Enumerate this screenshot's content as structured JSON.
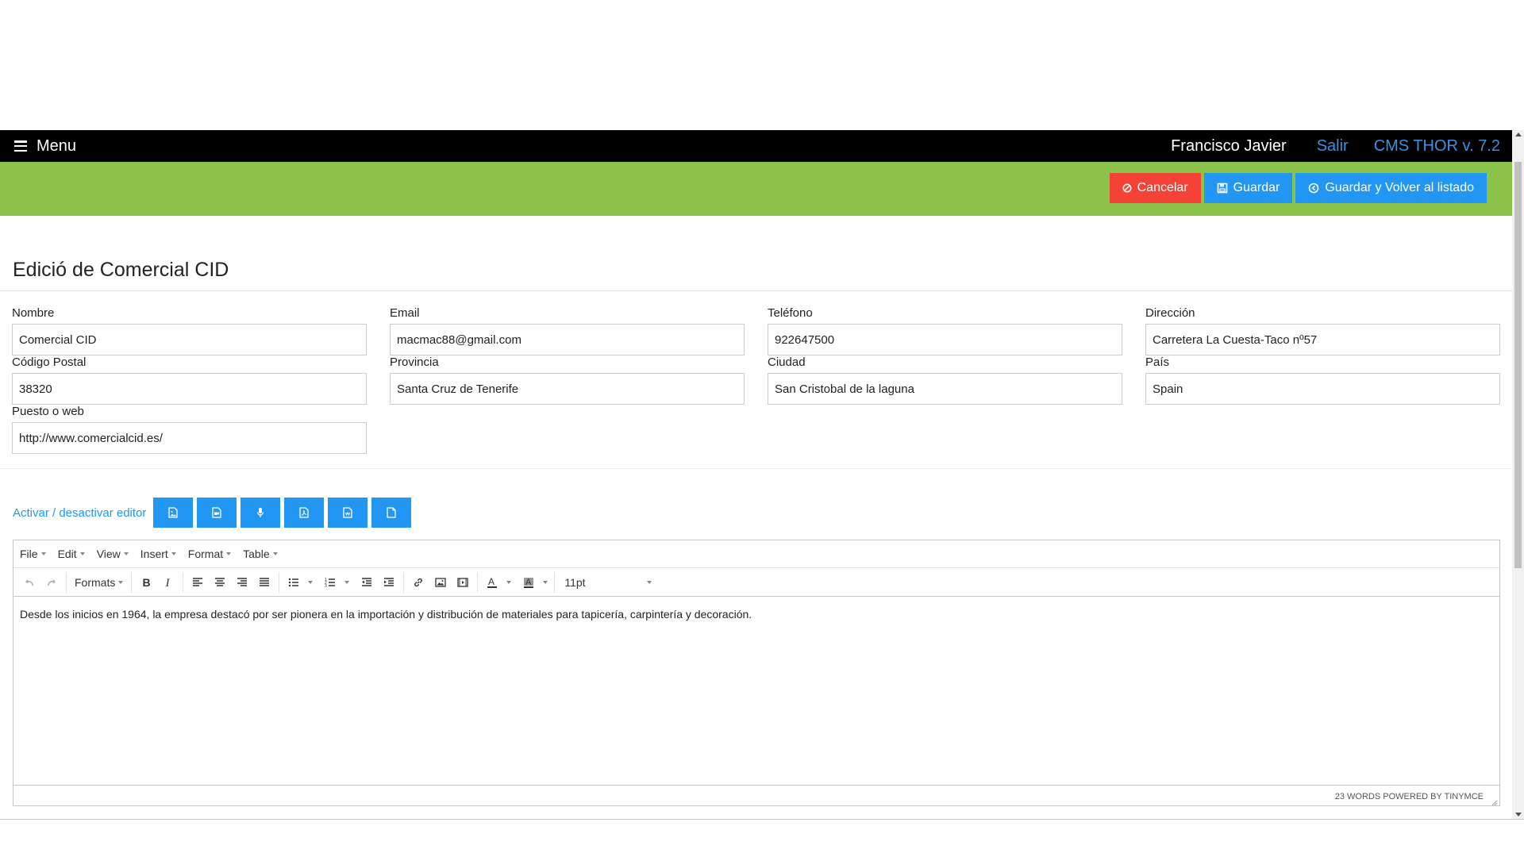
{
  "nav": {
    "menu_label": "Menu",
    "user_name": "Francisco Javier",
    "logout_label": "Salir",
    "version_label": "CMS THOR v. 7.2"
  },
  "actions": {
    "cancel_label": "Cancelar",
    "save_label": "Guardar",
    "save_return_label": "Guardar y Volver al listado"
  },
  "page": {
    "title": "Edició de Comercial CID"
  },
  "fields": {
    "nombre": {
      "label": "Nombre",
      "value": "Comercial CID"
    },
    "email": {
      "label": "Email",
      "value": "macmac88@gmail.com"
    },
    "telefono": {
      "label": "Teléfono",
      "value": "922647500"
    },
    "direccion": {
      "label": "Dirección",
      "value": "Carretera La Cuesta-Taco nº57"
    },
    "codigo_postal": {
      "label": "Código Postal",
      "value": "38320"
    },
    "provincia": {
      "label": "Provincia",
      "value": "Santa Cruz de Tenerife"
    },
    "ciudad": {
      "label": "Ciudad",
      "value": "San Cristobal de la laguna"
    },
    "pais": {
      "label": "País",
      "value": "Spain"
    },
    "web": {
      "label": "Puesto o web",
      "value": "http://www.comercialcid.es/"
    }
  },
  "editor": {
    "toggle_label": "Activar / desactivar editor",
    "media_buttons": [
      "insert-image-icon",
      "insert-video-icon",
      "insert-audio-icon",
      "insert-pdf-icon",
      "insert-pdf-doc-icon",
      "insert-file-icon"
    ],
    "menubar": {
      "file": "File",
      "edit": "Edit",
      "view": "View",
      "insert": "Insert",
      "format": "Format",
      "table": "Table"
    },
    "formats_label": "Formats",
    "fontsize_value": "11pt",
    "content": "Desde los inicios en 1964, la empresa destacó por ser pionera en la importación y distribución de materiales para tapicería, carpintería y decoración.",
    "status": "23 WORDS POWERED BY TINYMCE"
  },
  "colors": {
    "topbar": "#000000",
    "actionbar": "#8bc34a",
    "cancel": "#f44336",
    "primary": "#2196f3",
    "link": "#3d8fe0"
  }
}
